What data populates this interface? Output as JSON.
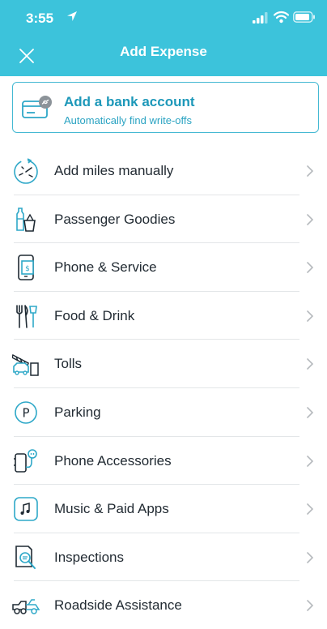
{
  "status_bar": {
    "time": "3:55"
  },
  "header": {
    "title": "Add Expense"
  },
  "bank_card": {
    "title": "Add a bank account",
    "subtitle": "Automatically find write-offs"
  },
  "items": [
    {
      "label": "Add miles manually",
      "icon": "odometer-icon"
    },
    {
      "label": "Passenger Goodies",
      "icon": "bottle-basket-icon"
    },
    {
      "label": "Phone & Service",
      "icon": "phone-bill-icon"
    },
    {
      "label": "Food & Drink",
      "icon": "fork-knife-icon"
    },
    {
      "label": "Tolls",
      "icon": "toll-gate-icon"
    },
    {
      "label": "Parking",
      "icon": "parking-icon"
    },
    {
      "label": "Phone Accessories",
      "icon": "phone-charger-icon"
    },
    {
      "label": "Music & Paid Apps",
      "icon": "music-note-icon"
    },
    {
      "label": "Inspections",
      "icon": "magnifier-document-icon"
    },
    {
      "label": "Roadside Assistance",
      "icon": "tow-truck-icon"
    }
  ],
  "colors": {
    "header_bg": "#3cc3db",
    "accent": "#1d98b9",
    "icon_stroke": "#2ea8c8"
  }
}
